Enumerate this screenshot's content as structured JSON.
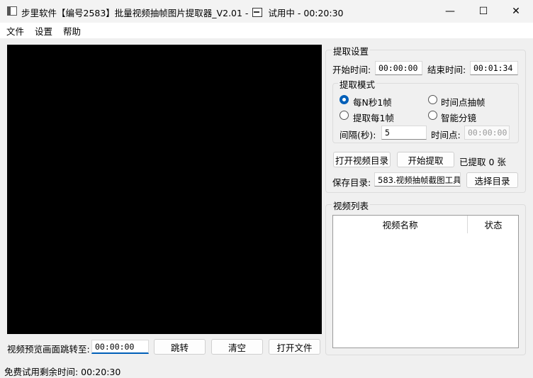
{
  "window": {
    "title_prefix": "步里软件【编号2583】批量视频抽帧图片提取器_V2.01 -",
    "title_suffix": "试用中 - 00:20:30",
    "minimize": "—",
    "maximize": "☐",
    "close": "✕"
  },
  "menu": [
    "文件",
    "设置",
    "帮助"
  ],
  "settings": {
    "group_title": "提取设置",
    "start_label": "开始时间:",
    "start_value": "00:00:00",
    "end_label": "结束时间:",
    "end_value": "00:01:34",
    "mode_title": "提取模式",
    "modes": [
      {
        "label": "每N秒1帧",
        "selected": true
      },
      {
        "label": "时间点抽帧",
        "selected": false
      },
      {
        "label": "提取每1帧",
        "selected": false
      },
      {
        "label": "智能分镜",
        "selected": false
      }
    ],
    "interval_label": "间隔(秒):",
    "interval_value": "5",
    "timepoint_label": "时间点:",
    "timepoint_value": "00:00:00",
    "open_dir_button": "打开视频目录",
    "start_button": "开始提取",
    "extracted_text": "已提取 0 张",
    "save_dir_label": "保存目录:",
    "save_dir_value": "583.视频抽帧截图工具",
    "choose_dir_button": "选择目录"
  },
  "video_list": {
    "title": "视频列表",
    "columns": [
      "视频名称",
      "状态"
    ],
    "rows": []
  },
  "preview_controls": {
    "jump_label": "视频预览画面跳转至:",
    "jump_value": "00:00:00",
    "jump_button": "跳转",
    "clear_button": "清空",
    "open_file_button": "打开文件"
  },
  "status_bar": {
    "text": "免费试用剩余时间: 00:20:30"
  },
  "colors": {
    "accent": "#005fb8",
    "preview_bg": "#000000",
    "window_bg": "#f0f0f0"
  }
}
